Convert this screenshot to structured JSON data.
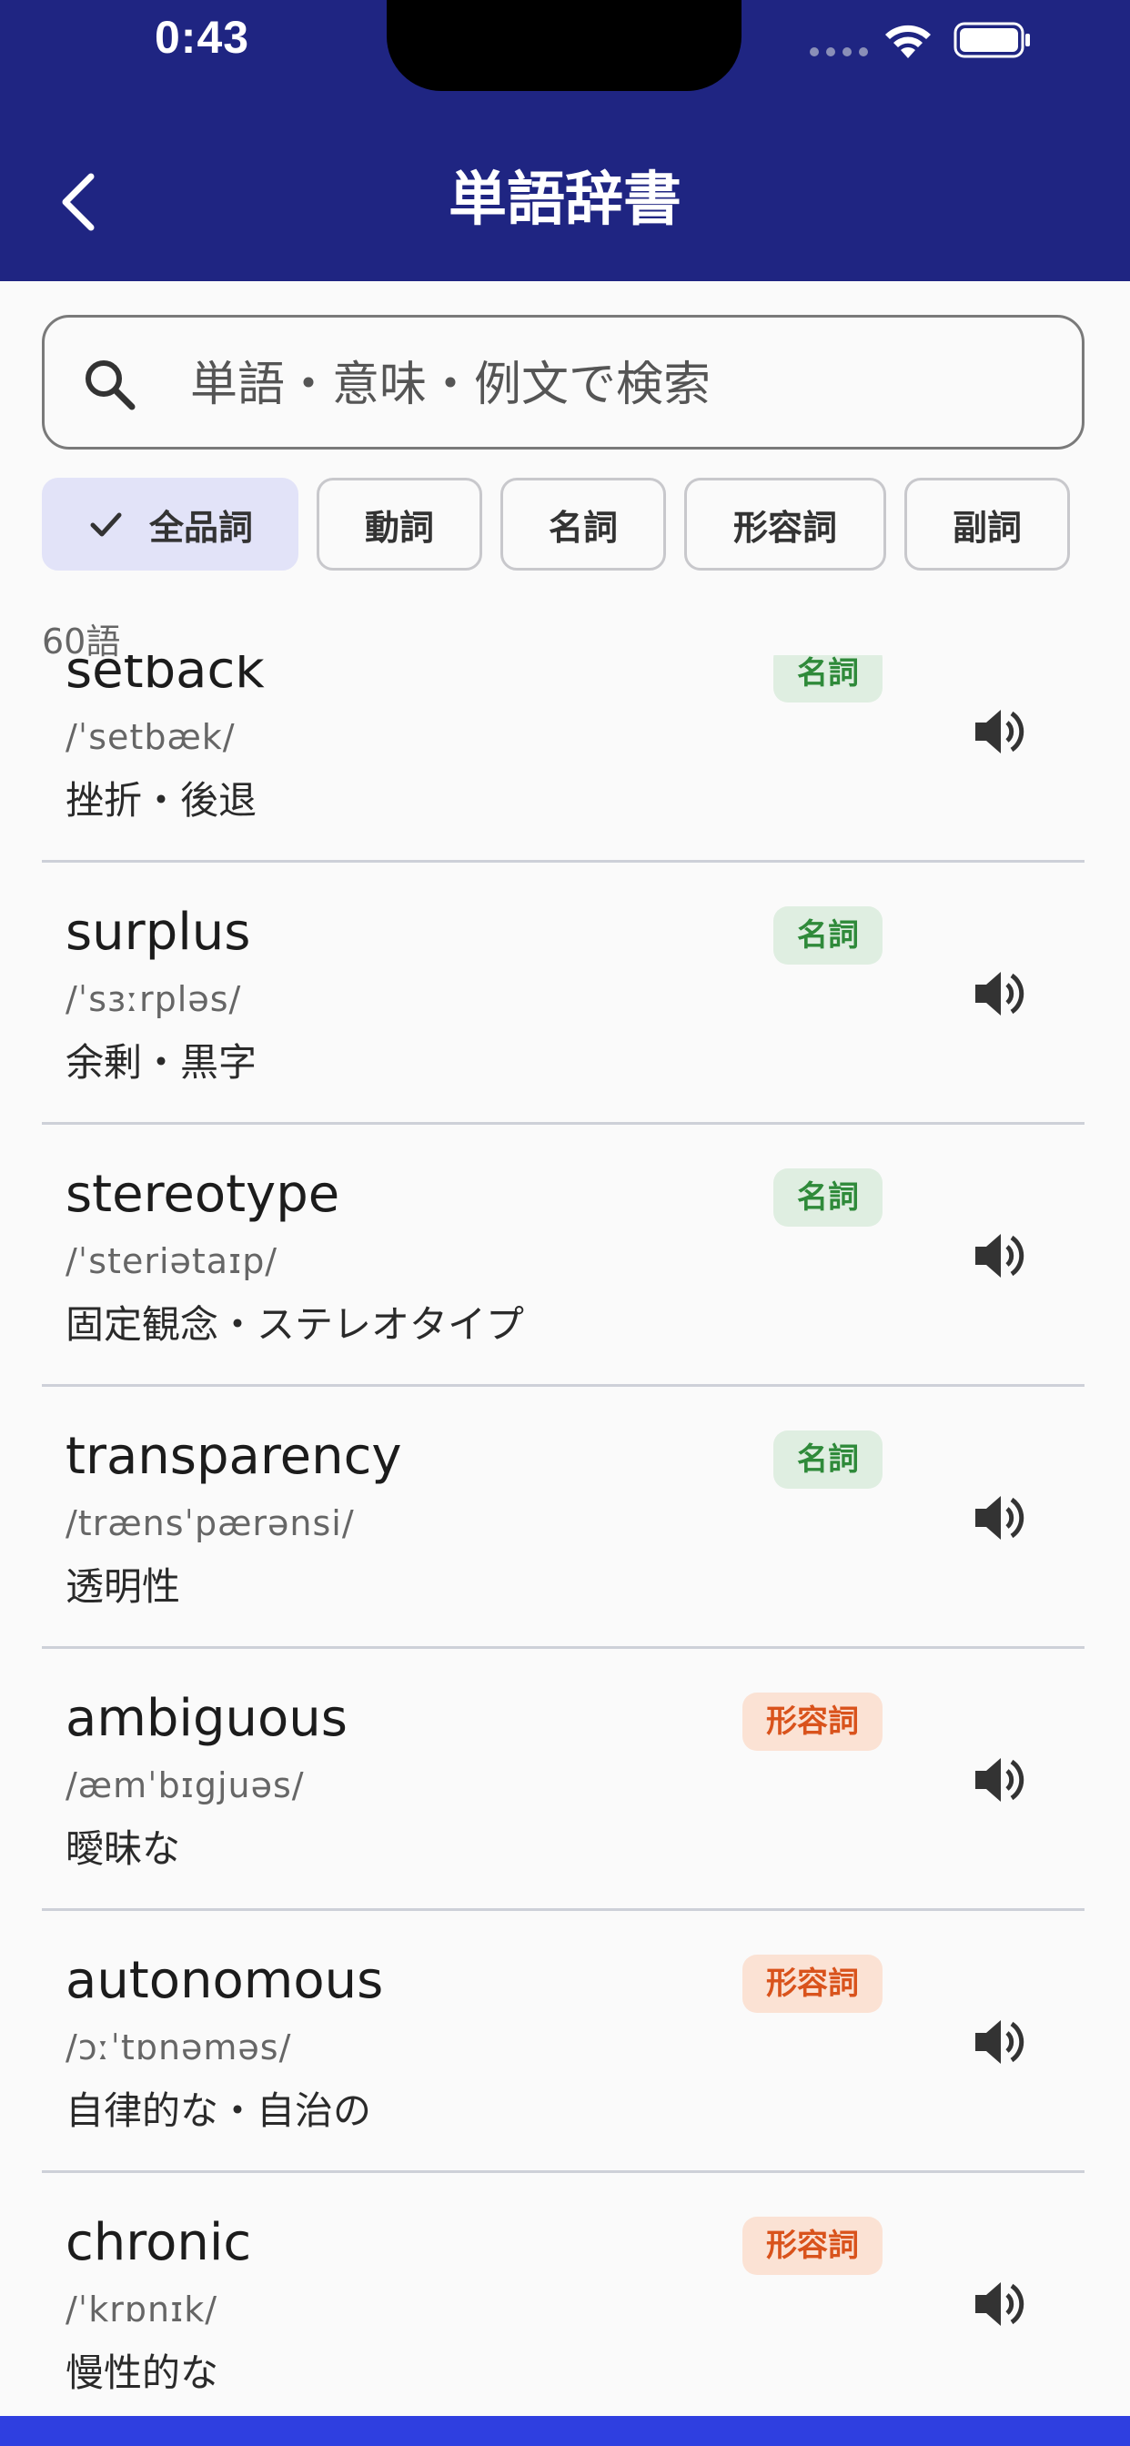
{
  "status": {
    "time": "0:43"
  },
  "header": {
    "title": "単語辞書",
    "back_icon": "chevron-left-icon"
  },
  "search": {
    "placeholder": "単語・意味・例文で検索",
    "value": ""
  },
  "filters": [
    {
      "label": "全品詞",
      "selected": true
    },
    {
      "label": "動詞",
      "selected": false
    },
    {
      "label": "名詞",
      "selected": false
    },
    {
      "label": "形容詞",
      "selected": false
    },
    {
      "label": "副詞",
      "selected": false
    }
  ],
  "word_count": "60語",
  "colors": {
    "appbar": "#1f2582",
    "noun_badge_bg": "#dfeee1",
    "noun_badge_text": "#2f8a3a",
    "adj_badge_bg": "#fbe2d4",
    "adj_badge_text": "#d9531c"
  },
  "words": [
    {
      "word": "setback",
      "ipa": "/ˈsetbæk/",
      "meaning": "挫折・後退",
      "pos": "名詞",
      "pos_type": "noun"
    },
    {
      "word": "surplus",
      "ipa": "/ˈsɜːrpləs/",
      "meaning": "余剰・黒字",
      "pos": "名詞",
      "pos_type": "noun"
    },
    {
      "word": "stereotype",
      "ipa": "/ˈsteriətaɪp/",
      "meaning": "固定観念・ステレオタイプ",
      "pos": "名詞",
      "pos_type": "noun"
    },
    {
      "word": "transparency",
      "ipa": "/trænsˈpærənsi/",
      "meaning": "透明性",
      "pos": "名詞",
      "pos_type": "noun"
    },
    {
      "word": "ambiguous",
      "ipa": "/æmˈbɪgjuəs/",
      "meaning": "曖昧な",
      "pos": "形容詞",
      "pos_type": "adj"
    },
    {
      "word": "autonomous",
      "ipa": "/ɔːˈtɒnəməs/",
      "meaning": "自律的な・自治の",
      "pos": "形容詞",
      "pos_type": "adj"
    },
    {
      "word": "chronic",
      "ipa": "/ˈkrɒnɪk/",
      "meaning": "慢性的な",
      "pos": "形容詞",
      "pos_type": "adj"
    }
  ]
}
